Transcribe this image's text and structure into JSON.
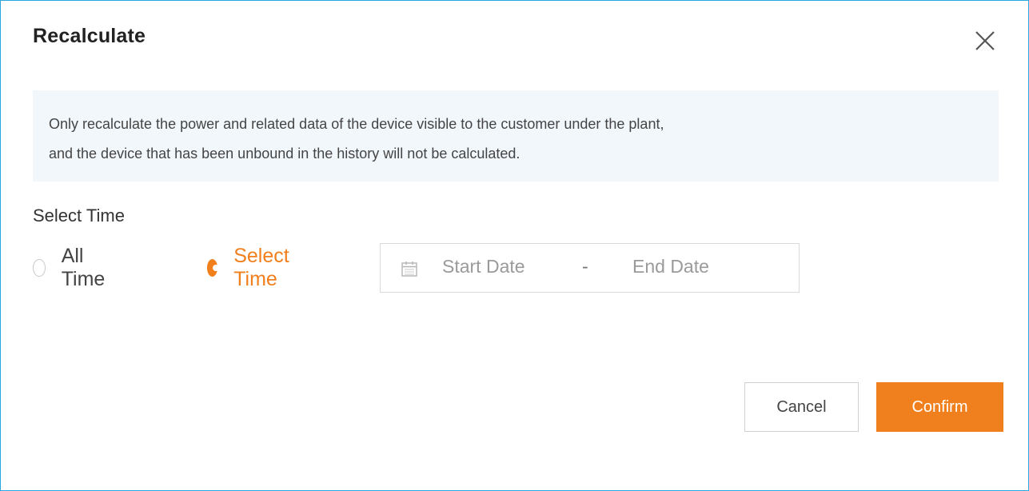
{
  "dialog": {
    "title": "Recalculate",
    "close_icon": "close-icon",
    "notice_line1": "Only recalculate the power and related data of the device visible to the customer under the plant,",
    "notice_line2": "and the device that has been unbound in the history will not be calculated."
  },
  "time_selection": {
    "label": "Select Time",
    "options": [
      {
        "label": "All Time",
        "selected": false
      },
      {
        "label": "Select Time",
        "selected": true
      }
    ],
    "date_range": {
      "icon": "calendar-icon",
      "start_placeholder": "Start Date",
      "separator": "-",
      "end_placeholder": "End Date"
    }
  },
  "footer": {
    "cancel_label": "Cancel",
    "confirm_label": "Confirm"
  },
  "colors": {
    "accent": "#f0801e",
    "border": "#29a8e0",
    "notice_background": "#f2f7fc"
  }
}
